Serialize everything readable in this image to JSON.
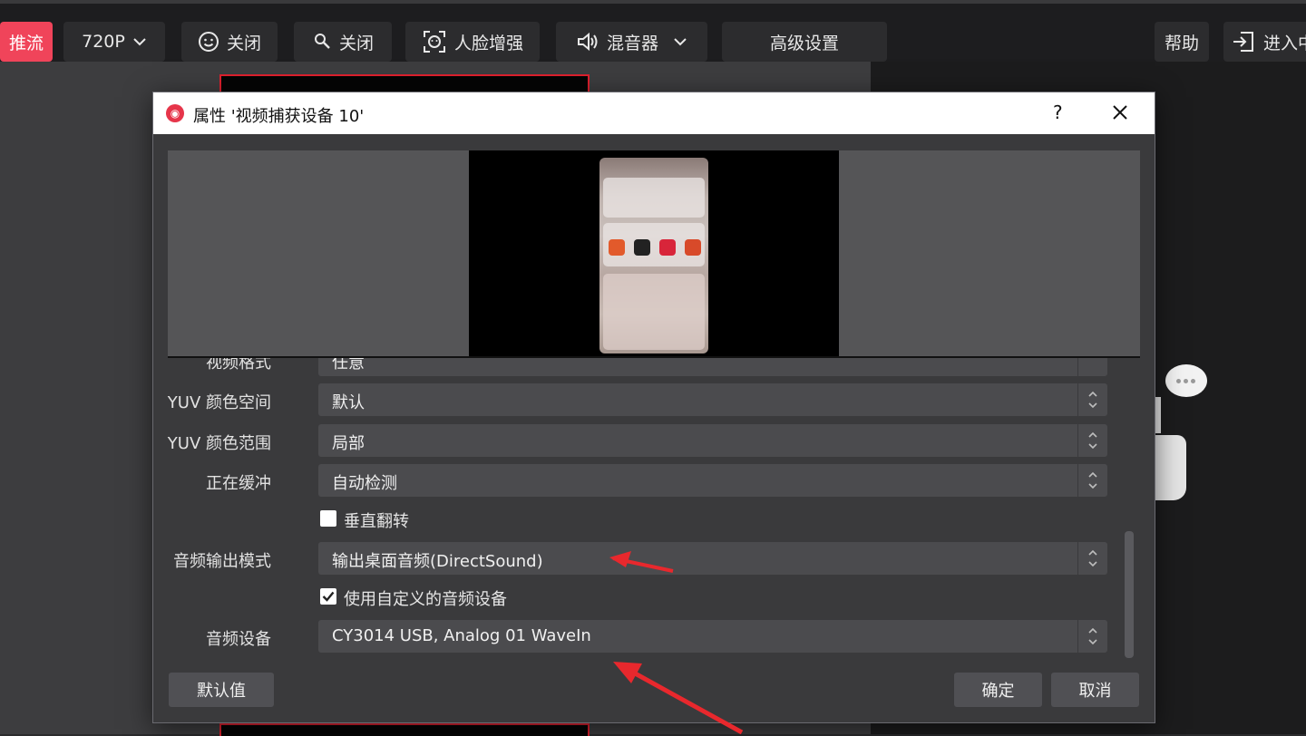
{
  "toolbar": {
    "live_label": "推流",
    "resolution_label": "720P",
    "beauty_label": "关闭",
    "filter_label": "关闭",
    "face_label": "人脸增强",
    "mixer_label": "混音器",
    "advanced_label": "高级设置",
    "help_label": "帮助",
    "enter_label": "进入中"
  },
  "dialog": {
    "title": "属性 '视频捕获设备 10'",
    "help_symbol": "?",
    "fields": [
      {
        "label": "视频格式",
        "value": "任意"
      },
      {
        "label": "YUV 颜色空间",
        "value": "默认"
      },
      {
        "label": "YUV 颜色范围",
        "value": "局部"
      },
      {
        "label": "正在缓冲",
        "value": "自动检测"
      },
      {
        "label": "音频输出模式",
        "value": "输出桌面音频(DirectSound)"
      },
      {
        "label": "音频设备",
        "value": "CY3014 USB, Analog 01 WaveIn"
      }
    ],
    "vflip_label": "垂直翻转",
    "vflip_checked": false,
    "custom_audio_label": "使用自定义的音频设备",
    "custom_audio_checked": true,
    "defaults_button": "默认值",
    "ok_button": "确定",
    "cancel_button": "取消"
  },
  "colors": {
    "accent": "#f0445a",
    "annotation_arrow": "#e8282d"
  }
}
